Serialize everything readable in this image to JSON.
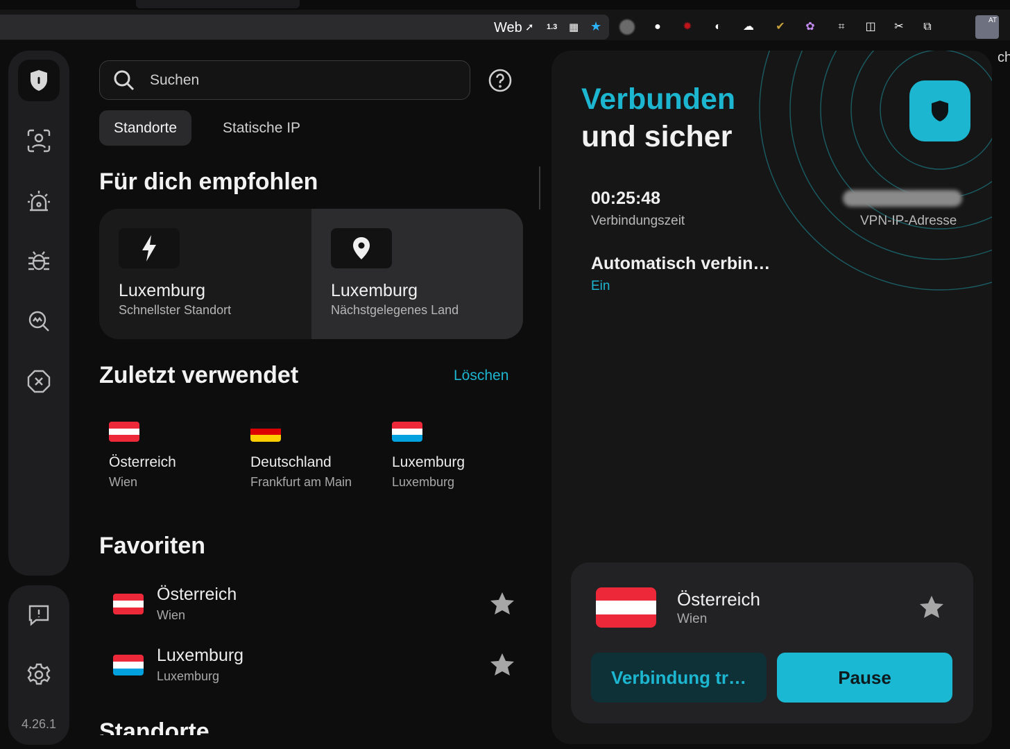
{
  "browser": {
    "toolbar_text": "Web",
    "badge_value": "1.3",
    "ext_badge": "AT",
    "edge_text": "ch"
  },
  "rail": {
    "version": "4.26.1"
  },
  "search": {
    "placeholder": "Suchen"
  },
  "tabs": [
    {
      "label": "Standorte",
      "active": true
    },
    {
      "label": "Statische IP",
      "active": false
    }
  ],
  "recommended": {
    "heading": "Für dich empfohlen",
    "cards": [
      {
        "title": "Luxemburg",
        "subtitle": "Schnellster Standort",
        "icon": "lightning-icon"
      },
      {
        "title": "Luxemburg",
        "subtitle": "Nächstgelegenes Land",
        "icon": "location-pin-icon"
      }
    ]
  },
  "recent": {
    "heading": "Zuletzt verwendet",
    "clear_label": "Löschen",
    "items": [
      {
        "name": "Österreich",
        "city": "Wien",
        "flag": "at"
      },
      {
        "name": "Deutschland",
        "city": "Frankfurt am Main",
        "flag": "de"
      },
      {
        "name": "Luxemburg",
        "city": "Luxemburg",
        "flag": "lu"
      }
    ]
  },
  "favorites": {
    "heading": "Favoriten",
    "items": [
      {
        "name": "Österreich",
        "city": "Wien",
        "flag": "at"
      },
      {
        "name": "Luxemburg",
        "city": "Luxemburg",
        "flag": "lu"
      }
    ]
  },
  "locations_heading": "Standorte",
  "status": {
    "line1": "Verbunden",
    "line2": "und sicher",
    "connection_time": "00:25:48",
    "connection_time_label": "Verbindungszeit",
    "vpn_ip_label": "VPN-IP-Adresse",
    "auto_connect_label": "Automatisch verbin…",
    "auto_connect_value": "Ein"
  },
  "current": {
    "name": "Österreich",
    "city": "Wien",
    "disconnect_label": "Verbindung tr…",
    "pause_label": "Pause"
  },
  "colors": {
    "accent": "#1db6d0",
    "background": "#0d0d0e",
    "card": "#222224",
    "austria_red": "#ed2939",
    "germany_red": "#dd0000",
    "germany_gold": "#ffce00",
    "luxembourg_red": "#ed2939",
    "luxembourg_blue": "#00a1de"
  }
}
